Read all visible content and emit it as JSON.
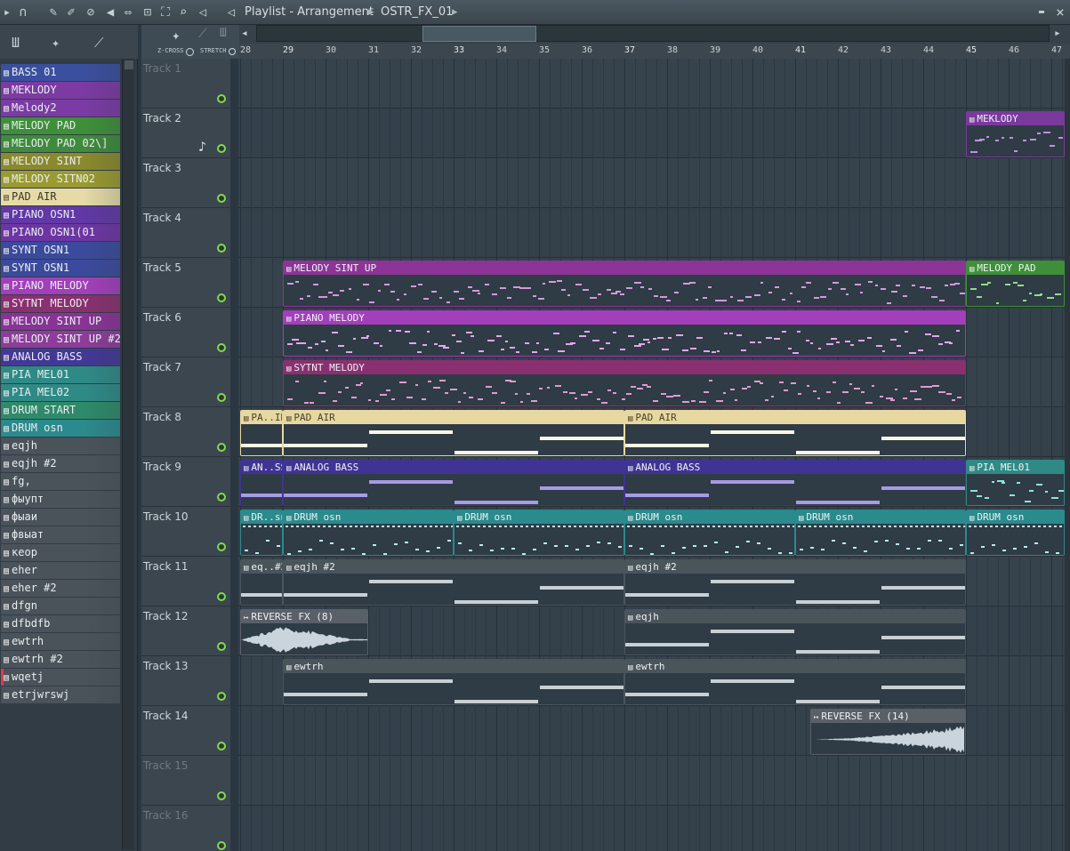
{
  "titlebar": {
    "title": "Playlist - Arrangement",
    "pattern": "OSTR_FX_01",
    "icons": [
      "play-arrow-icon",
      "magnet-icon",
      "pencil-icon",
      "brush-icon",
      "mute-icon",
      "speaker-icon",
      "slip-icon",
      "select-icon",
      "zoom-icon",
      "playback-icon",
      "volume-icon",
      "minimize-icon",
      "close-icon"
    ],
    "minimize_glyph": "▬",
    "close_glyph": "×",
    "chevron_glyph": "▸"
  },
  "channels": [
    {
      "name": "BASS 01",
      "color": "#3a4f9e"
    },
    {
      "name": "MEKLODY",
      "color": "#7c3aa2"
    },
    {
      "name": "Melody2",
      "color": "#7b3ba5"
    },
    {
      "name": "MELODY PAD",
      "color": "#3f8f3a"
    },
    {
      "name": "MELODY PAD 02\\]",
      "color": "#3f8a3c"
    },
    {
      "name": "MELODY SINT",
      "color": "#8a8a2c"
    },
    {
      "name": "MELODY SITN02",
      "color": "#9a9a30"
    },
    {
      "name": "PAD AIR",
      "color": "#e6dba6",
      "light": true
    },
    {
      "name": "PIANO OSN1",
      "color": "#6138a6"
    },
    {
      "name": "PIANO OSN1(01",
      "color": "#6d35a4"
    },
    {
      "name": "SYNT OSN1",
      "color": "#3b4a9c"
    },
    {
      "name": "SYNT OSN1",
      "color": "#3b4a9c"
    },
    {
      "name": "PIANO MELODY",
      "color": "#a33fba"
    },
    {
      "name": "SYTNT MELODY",
      "color": "#8a3070"
    },
    {
      "name": "MELODY SINT UP",
      "color": "#8a3396"
    },
    {
      "name": "MELODY SINT UP #2",
      "color": "#8d3c9a"
    },
    {
      "name": "ANALOG BASS",
      "color": "#433896"
    },
    {
      "name": "PIA MEL01",
      "color": "#2f8a86"
    },
    {
      "name": "PIA MEL02",
      "color": "#2f8a86"
    },
    {
      "name": "DRUM START",
      "color": "#2e8a6a"
    },
    {
      "name": "DRUM osn",
      "color": "#2b8a8d"
    },
    {
      "name": "eqjh",
      "color": "#4a535a"
    },
    {
      "name": "eqjh #2",
      "color": "#4a535a"
    },
    {
      "name": "fg,",
      "color": "#4a535a"
    },
    {
      "name": "фыупт",
      "color": "#4a535a"
    },
    {
      "name": "фыаи",
      "color": "#4a535a"
    },
    {
      "name": "фвыат",
      "color": "#4a535a"
    },
    {
      "name": "кеор",
      "color": "#4a535a"
    },
    {
      "name": "eher",
      "color": "#4a535a"
    },
    {
      "name": "eher #2",
      "color": "#4a535a"
    },
    {
      "name": "dfgn",
      "color": "#4a535a"
    },
    {
      "name": "dfbdfb",
      "color": "#4a535a"
    },
    {
      "name": "ewtrh",
      "color": "#4a535a"
    },
    {
      "name": "ewtrh #2",
      "color": "#4a535a"
    },
    {
      "name": "wqetj",
      "color": "#4a535a",
      "selected": true
    },
    {
      "name": "etrjwrswj",
      "color": "#4a535a"
    }
  ],
  "toolstrip": {
    "zcross": "Z-CROSS",
    "stretch": "STRETCH"
  },
  "timeline": {
    "bars": [
      28,
      29,
      30,
      31,
      32,
      33,
      34,
      35,
      36,
      37,
      38,
      39,
      40,
      41,
      42,
      43,
      44,
      45,
      46,
      47
    ],
    "major": [
      29,
      33,
      37,
      41,
      45
    ]
  },
  "tracks": [
    {
      "label": "Track 1",
      "dim": true
    },
    {
      "label": "Track 2",
      "note": "♪"
    },
    {
      "label": "Track 3"
    },
    {
      "label": "Track 4"
    },
    {
      "label": "Track 5"
    },
    {
      "label": "Track 6"
    },
    {
      "label": "Track 7"
    },
    {
      "label": "Track 8"
    },
    {
      "label": "Track 9"
    },
    {
      "label": "Track 10"
    },
    {
      "label": "Track 11"
    },
    {
      "label": "Track 12"
    },
    {
      "label": "Track 13"
    },
    {
      "label": "Track 14"
    },
    {
      "label": "Track 15",
      "dim": true
    },
    {
      "label": "Track 16",
      "dim": true
    }
  ],
  "clips": [
    {
      "track": 2,
      "start": 45,
      "end": 48,
      "label": "MEKLODY",
      "color": "#7a3a9c",
      "kind": "melody",
      "note": "#c48ee0",
      "icon": "▤"
    },
    {
      "track": 5,
      "start": 29,
      "end": 45,
      "label": "MELODY SINT UP",
      "color": "#8c3596",
      "kind": "melody",
      "note": "#d797e0",
      "icon": "▤"
    },
    {
      "track": 5,
      "start": 45,
      "end": 48,
      "label": "MELODY PAD",
      "color": "#3f8f3a",
      "kind": "melody",
      "note": "#8fe084",
      "icon": "▤"
    },
    {
      "track": 6,
      "start": 29,
      "end": 45,
      "label": "PIANO MELODY",
      "color": "#a33fba",
      "kind": "melody",
      "note": "#e3a6ee",
      "icon": "▤"
    },
    {
      "track": 7,
      "start": 29,
      "end": 45,
      "label": "SYTNT MELODY",
      "color": "#8a3070",
      "kind": "melody",
      "note": "#e09ad0",
      "icon": "▤"
    },
    {
      "track": 8,
      "start": 28,
      "end": 29,
      "label": "PA..IR",
      "color": "#e6d8a0",
      "kind": "pad",
      "note": "#fbf6e4",
      "light": true,
      "icon": "▤"
    },
    {
      "track": 8,
      "start": 29,
      "end": 37,
      "label": "PAD AIR",
      "color": "#e6d8a0",
      "kind": "pad",
      "note": "#fbf6e4",
      "light": true,
      "icon": "▤"
    },
    {
      "track": 8,
      "start": 37,
      "end": 45,
      "label": "PAD AIR",
      "color": "#e6d8a0",
      "kind": "pad",
      "note": "#fbf6e4",
      "light": true,
      "icon": "▤"
    },
    {
      "track": 9,
      "start": 28,
      "end": 29,
      "label": "AN..SS",
      "color": "#3f3494",
      "kind": "pad",
      "note": "#a89ae6",
      "icon": "▤"
    },
    {
      "track": 9,
      "start": 29,
      "end": 37,
      "label": "ANALOG BASS",
      "color": "#3f3494",
      "kind": "pad",
      "note": "#a89ae6",
      "icon": "▤"
    },
    {
      "track": 9,
      "start": 37,
      "end": 45,
      "label": "ANALOG BASS",
      "color": "#3f3494",
      "kind": "pad",
      "note": "#a89ae6",
      "icon": "▤"
    },
    {
      "track": 9,
      "start": 45,
      "end": 48,
      "label": "PIA MEL01",
      "color": "#2f8a86",
      "kind": "melody",
      "note": "#8fe3dc",
      "icon": "▤"
    },
    {
      "track": 10,
      "start": 28,
      "end": 29,
      "label": "DR..sn",
      "color": "#2a8a8c",
      "kind": "drum",
      "note": "#b6ecee",
      "icon": "▤"
    },
    {
      "track": 10,
      "start": 29,
      "end": 33,
      "label": "DRUM osn",
      "color": "#2a8a8c",
      "kind": "drum",
      "note": "#b6ecee",
      "icon": "▤"
    },
    {
      "track": 10,
      "start": 33,
      "end": 37,
      "label": "DRUM osn",
      "color": "#2a8a8c",
      "kind": "drum",
      "note": "#b6ecee",
      "icon": "▤"
    },
    {
      "track": 10,
      "start": 37,
      "end": 41,
      "label": "DRUM osn",
      "color": "#2a8a8c",
      "kind": "drum",
      "note": "#b6ecee",
      "icon": "▤"
    },
    {
      "track": 10,
      "start": 41,
      "end": 45,
      "label": "DRUM osn",
      "color": "#2a8a8c",
      "kind": "drum",
      "note": "#b6ecee",
      "icon": "▤"
    },
    {
      "track": 10,
      "start": 45,
      "end": 48,
      "label": "DRUM osn",
      "color": "#2a8a8c",
      "kind": "drum",
      "note": "#b6ecee",
      "icon": "▤"
    },
    {
      "track": 11,
      "start": 28,
      "end": 29,
      "label": "eq..#2",
      "color": "#4a545b",
      "kind": "pad",
      "note": "#c8d0d5",
      "icon": "▤"
    },
    {
      "track": 11,
      "start": 29,
      "end": 37,
      "label": "eqjh #2",
      "color": "#4a545b",
      "kind": "pad",
      "note": "#c8d0d5",
      "icon": "▤"
    },
    {
      "track": 11,
      "start": 37,
      "end": 45,
      "label": "eqjh #2",
      "color": "#4a545b",
      "kind": "pad",
      "note": "#c8d0d5",
      "icon": "▤"
    },
    {
      "track": 12,
      "start": 28,
      "end": 31,
      "label": "REVERSE FX (8)",
      "color": "#5a6068",
      "kind": "wave",
      "note": "#c9d4dc",
      "icon": "↦"
    },
    {
      "track": 12,
      "start": 37,
      "end": 45,
      "label": "eqjh",
      "color": "#4a545b",
      "kind": "pad",
      "note": "#c8d0d5",
      "icon": "▤"
    },
    {
      "track": 13,
      "start": 29,
      "end": 37,
      "label": "ewtrh",
      "color": "#4a545b",
      "kind": "pad",
      "note": "#c8d0d5",
      "icon": "▤"
    },
    {
      "track": 13,
      "start": 37,
      "end": 45,
      "label": "ewtrh",
      "color": "#4a545b",
      "kind": "pad",
      "note": "#c8d0d5",
      "icon": "▤"
    },
    {
      "track": 14,
      "start": 41.35,
      "end": 45,
      "label": "REVERSE FX (14)",
      "color": "#5a6068",
      "kind": "wavein",
      "note": "#c9d4dc",
      "icon": "↦"
    }
  ]
}
